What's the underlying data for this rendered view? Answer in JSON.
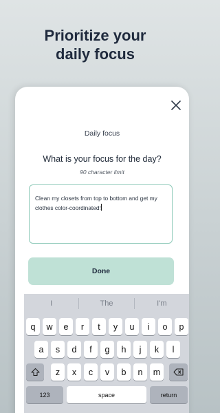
{
  "headline": {
    "line1": "Prioritize your",
    "line2": "daily focus"
  },
  "screen": {
    "title": "Daily focus",
    "question": "What is your focus for the day?",
    "limit": "90 character limit",
    "input_value": "Clean my closets from top to bottom and get my clothes color-coordinated!",
    "done_label": "Done"
  },
  "keyboard": {
    "suggestions": [
      "I",
      "The",
      "I'm"
    ],
    "row1": [
      "q",
      "w",
      "e",
      "r",
      "t",
      "y",
      "u",
      "i",
      "o",
      "p"
    ],
    "row2": [
      "a",
      "s",
      "d",
      "f",
      "g",
      "h",
      "j",
      "k",
      "l"
    ],
    "row3": [
      "z",
      "x",
      "c",
      "v",
      "b",
      "n",
      "m"
    ],
    "numbers_label": "123",
    "space_label": "space",
    "return_label": "return",
    "shift_icon": "shift-icon",
    "backspace_icon": "backspace-icon"
  },
  "colors": {
    "accent": "#8fcab9",
    "button": "#bfe1d6",
    "text": "#1f2a3d"
  }
}
